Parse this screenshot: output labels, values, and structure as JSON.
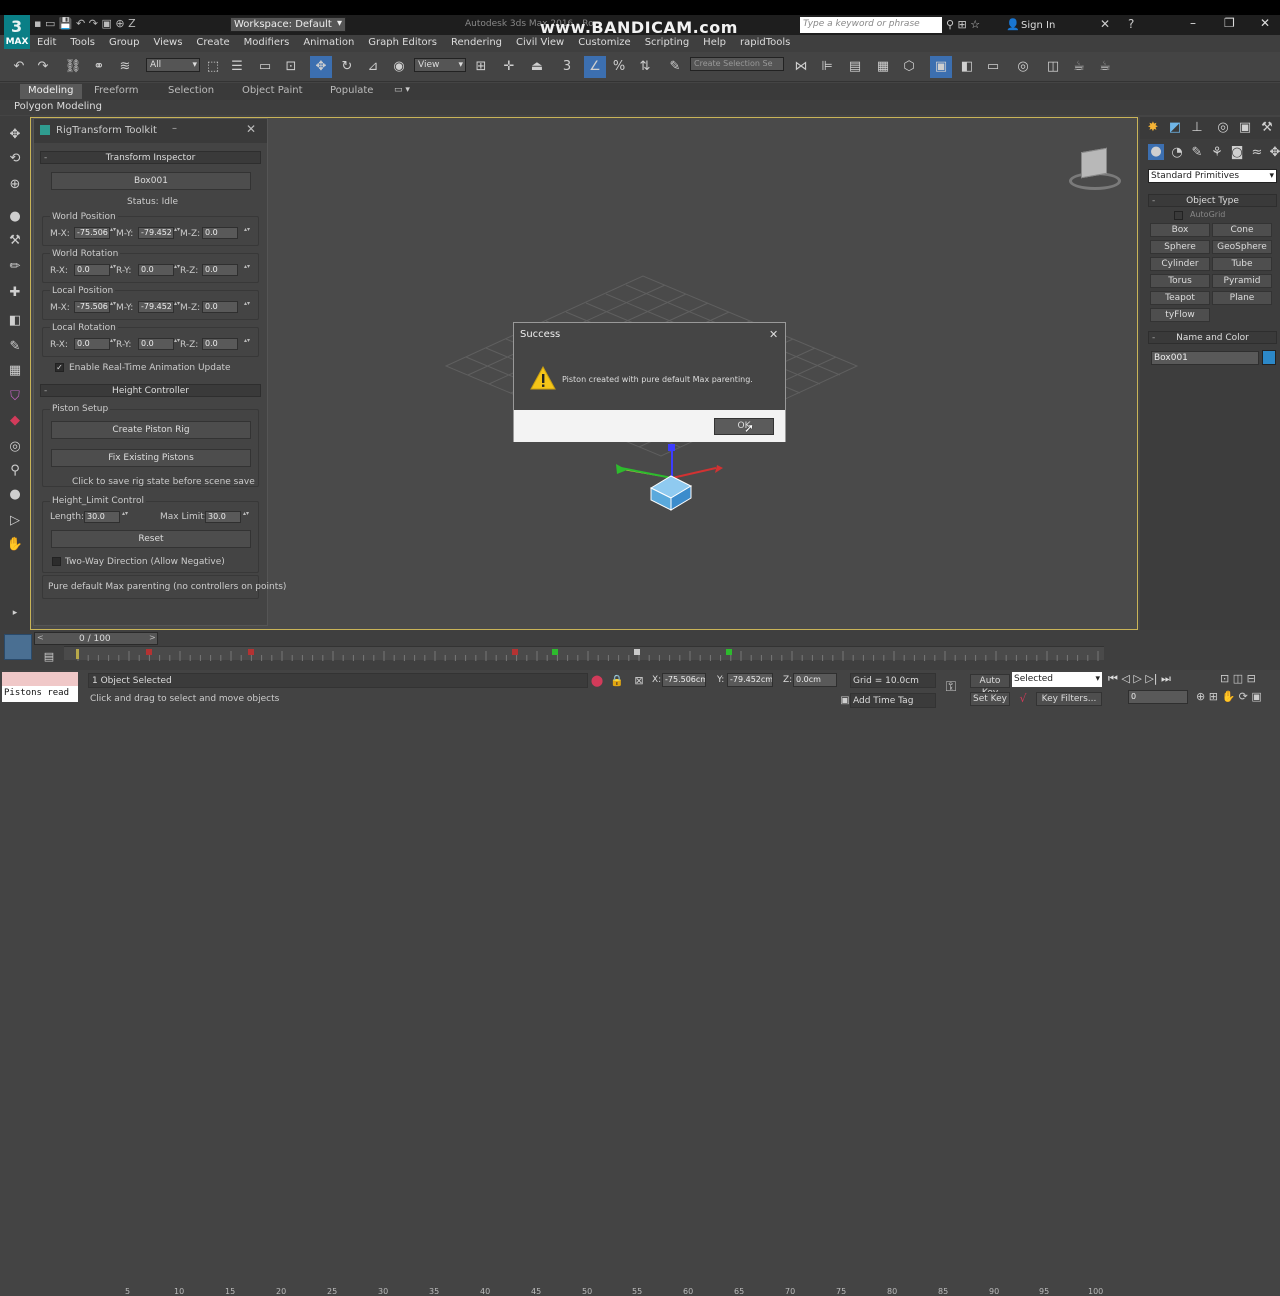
{
  "app": {
    "title": "Autodesk 3ds Max 2016 - Ro",
    "logo_label": "MAX",
    "watermark": "www.BANDICAM.com",
    "workspace": "Workspace: Default",
    "search_placeholder": "Type a keyword or phrase",
    "sign_in": "Sign In"
  },
  "menu": [
    "Edit",
    "Tools",
    "Group",
    "Views",
    "Create",
    "Modifiers",
    "Animation",
    "Graph Editors",
    "Rendering",
    "Civil View",
    "Customize",
    "Scripting",
    "Help",
    "rapidTools"
  ],
  "toolbar": {
    "filter_value": "All",
    "view_value": "View",
    "selection_set_placeholder": "Create Selection Se"
  },
  "ribbon": {
    "tabs": [
      "Modeling",
      "Freeform",
      "Selection",
      "Object Paint",
      "Populate"
    ],
    "active": "Modeling",
    "sub": "Polygon Modeling"
  },
  "rig": {
    "title": "RigTransform Toolkit",
    "inspector_header": "Transform Inspector",
    "object_name": "Box001",
    "status": "Status: Idle",
    "world_position": {
      "label": "World Position",
      "x_label": "M-X:",
      "y_label": "M-Y:",
      "z_label": "M-Z:",
      "x": "-75.506",
      "y": "-79.452",
      "z": "0.0"
    },
    "world_rotation": {
      "label": "World Rotation",
      "x_label": "R-X:",
      "y_label": "R-Y:",
      "z_label": "R-Z:",
      "x": "0.0",
      "y": "0.0",
      "z": "0.0"
    },
    "local_position": {
      "label": "Local Position",
      "x_label": "M-X:",
      "y_label": "M-Y:",
      "z_label": "M-Z:",
      "x": "-75.506",
      "y": "-79.452",
      "z": "0.0"
    },
    "local_rotation": {
      "label": "Local Rotation",
      "x_label": "R-X:",
      "y_label": "R-Y:",
      "z_label": "R-Z:",
      "x": "0.0",
      "y": "0.0",
      "z": "0.0"
    },
    "realtime_label": "Enable Real-Time Animation Update",
    "height_header": "Height Controller",
    "piston_setup": "Piston Setup",
    "create_piston": "Create Piston Rig",
    "fix_pistons": "Fix Existing Pistons",
    "save_hint": "Click to save rig state before scene save",
    "limit_group": "Height_Limit Control",
    "length_label": "Length:",
    "length_value": "30.0",
    "maxlimit_label": "Max Limit:",
    "maxlimit_value": "30.0",
    "reset": "Reset",
    "two_way": "Two-Way Direction (Allow Negative)",
    "footer": "Pure default Max parenting (no controllers on points)"
  },
  "dialog": {
    "title": "Success",
    "message": "Piston created with pure default Max parenting.",
    "ok": "OK"
  },
  "command_panel": {
    "category": "Standard Primitives",
    "object_type": "Object Type",
    "autogrid": "AutoGrid",
    "buttons": [
      "Box",
      "Cone",
      "Sphere",
      "GeoSphere",
      "Cylinder",
      "Tube",
      "Torus",
      "Pyramid",
      "Teapot",
      "Plane",
      "tyFlow"
    ],
    "name_color": "Name and Color",
    "name_value": "Box001",
    "object_color": "#2c88c8"
  },
  "timeline": {
    "frame": "0 / 100",
    "ticks": [
      "5",
      "10",
      "15",
      "20",
      "25",
      "30",
      "35",
      "40",
      "45",
      "50",
      "55",
      "60",
      "65",
      "70",
      "75",
      "80",
      "85",
      "90",
      "95",
      "100"
    ]
  },
  "status": {
    "listener": "Pistons read",
    "selected": "1 Object Selected",
    "prompt": "Click and drag to select and move objects",
    "x_label": "X:",
    "x": "-75.506cm",
    "y_label": "Y:",
    "y": "-79.452cm",
    "z_label": "Z:",
    "z": "0.0cm",
    "grid": "Grid = 10.0cm",
    "auto_key": "Auto Key",
    "selected_mode": "Selected",
    "set_key": "Set Key",
    "key_filters": "Key Filters...",
    "add_time_tag": "Add Time Tag",
    "frame_value": "0"
  }
}
